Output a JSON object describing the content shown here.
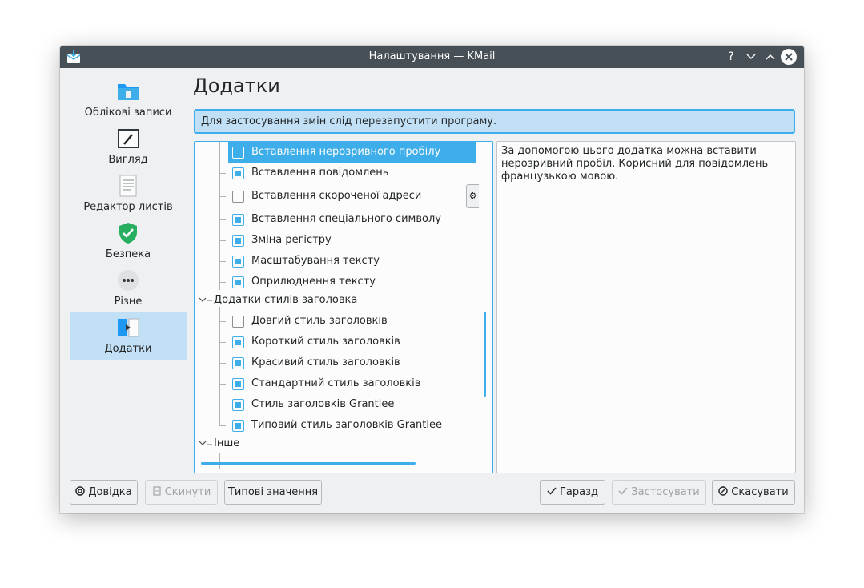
{
  "window": {
    "title": "Налаштування — KMail"
  },
  "titlebar_buttons": {
    "help": "?",
    "minimize": "⌄",
    "maximize": "⌃",
    "close": "✕"
  },
  "sidebar": {
    "items": [
      {
        "label": "Облікові записи",
        "icon": "folder-icon"
      },
      {
        "label": "Вигляд",
        "icon": "appearance-icon"
      },
      {
        "label": "Редактор листів",
        "icon": "document-icon"
      },
      {
        "label": "Безпека",
        "icon": "shield-icon"
      },
      {
        "label": "Різне",
        "icon": "more-icon"
      },
      {
        "label": "Додатки",
        "icon": "plugins-icon",
        "active": true
      }
    ]
  },
  "page": {
    "title": "Додатки",
    "info_message": "Для застосування змін слід перезапустити програму."
  },
  "tree": {
    "items": [
      {
        "label": "Вставлення нерозривного пробілу",
        "checked": false,
        "selected": true
      },
      {
        "label": "Вставлення повідомлень",
        "checked": true
      },
      {
        "label": "Вставлення скороченої адреси",
        "checked": false,
        "has_settings": true
      },
      {
        "label": "Вставлення спеціального символу",
        "checked": true
      },
      {
        "label": "Зміна регістру",
        "checked": true
      },
      {
        "label": "Масштабування тексту",
        "checked": true
      },
      {
        "label": "Оприлюднення тексту",
        "checked": true
      }
    ],
    "category_header_styles": "Додатки стилів заголовка",
    "header_items": [
      {
        "label": "Довгий стиль заголовків",
        "checked": false
      },
      {
        "label": "Короткий стиль заголовків",
        "checked": true
      },
      {
        "label": "Красивий стиль заголовків",
        "checked": true
      },
      {
        "label": "Стандартний стиль заголовків",
        "checked": true
      },
      {
        "label": "Стиль заголовків Grantlee",
        "checked": true
      },
      {
        "label": "Типовий стиль заголовків Grantlee",
        "checked": true
      }
    ],
    "category_other": "Інше"
  },
  "description": "За допомогою цього додатка можна вставити нерозривний пробіл. Корисний для повідомлень французькою мовою.",
  "buttons": {
    "help": "Довідка",
    "reset": "Скинути",
    "defaults": "Типові значення",
    "ok": "Гаразд",
    "apply": "Застосувати",
    "cancel": "Скасувати"
  },
  "colors": {
    "accent": "#3daee9",
    "titlebar": "#475057",
    "highlight": "#c2e0f5"
  }
}
